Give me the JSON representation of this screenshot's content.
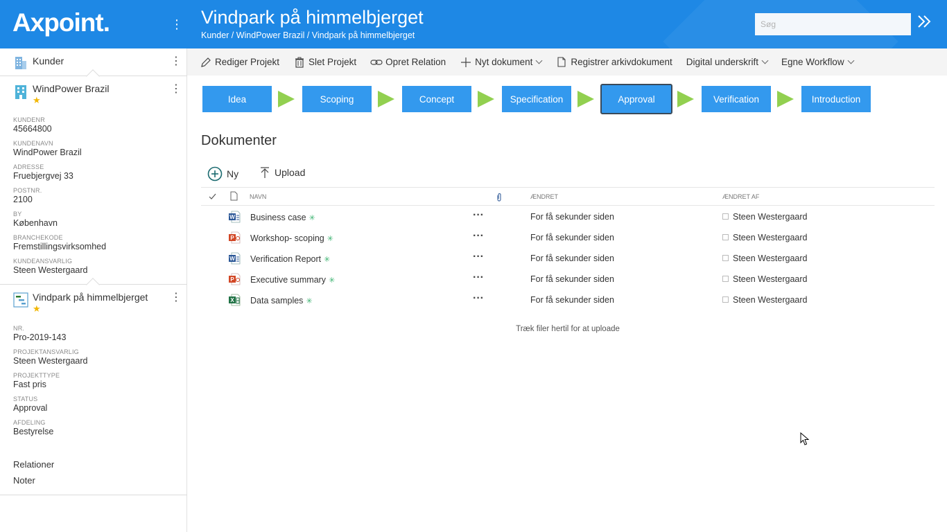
{
  "app": {
    "logo": "Axpoint."
  },
  "search": {
    "placeholder": "Søg"
  },
  "header": {
    "title": "Vindpark på himmelbjerget",
    "breadcrumb": [
      "Kunder",
      "WindPower Brazil",
      "Vindpark på himmelbjerget"
    ],
    "separator": " / "
  },
  "sidebar": {
    "root": {
      "label": "Kunder"
    },
    "customer": {
      "name": "WindPower Brazil",
      "starred": "★",
      "fields": [
        {
          "label": "KUNDENR",
          "value": "45664800"
        },
        {
          "label": "KUNDENAVN",
          "value": "WindPower Brazil"
        },
        {
          "label": "ADRESSE",
          "value": "Fruebjergvej 33"
        },
        {
          "label": "POSTNR.",
          "value": "2100"
        },
        {
          "label": "BY",
          "value": "København"
        },
        {
          "label": "BRANCHEKODE",
          "value": "Fremstillingsvirksomhed"
        },
        {
          "label": "KUNDEANSVARLIG",
          "value": "Steen Westergaard"
        }
      ]
    },
    "project": {
      "name": "Vindpark på himmelbjerget",
      "starred": "★",
      "fields": [
        {
          "label": "NR.",
          "value": "Pro-2019-143"
        },
        {
          "label": "PROJEKTANSVARLIG",
          "value": "Steen Westergaard"
        },
        {
          "label": "PROJEKTTYPE",
          "value": "Fast pris"
        },
        {
          "label": "STATUS",
          "value": "Approval"
        },
        {
          "label": "AFDELING",
          "value": "Bestyrelse"
        }
      ]
    },
    "links": [
      "Relationer",
      "Noter"
    ]
  },
  "toolbar": {
    "edit": "Rediger Projekt",
    "delete": "Slet Projekt",
    "relation": "Opret Relation",
    "new_doc": "Nyt dokument",
    "register": "Registrer arkivdokument",
    "signature": "Digital underskrift",
    "workflow": "Egne Workflow"
  },
  "phases": {
    "items": [
      "Idea",
      "Scoping",
      "Concept",
      "Specification",
      "Approval",
      "Verification",
      "Introduction"
    ],
    "active": "Approval"
  },
  "documents": {
    "title": "Dokumenter",
    "new_label": "Ny",
    "upload_label": "Upload",
    "columns": {
      "name": "NAVN",
      "modified": "ÆNDRET",
      "modified_by": "ÆNDRET AF"
    },
    "rows": [
      {
        "type": "word",
        "name": "Business case",
        "modified": "For få sekunder siden",
        "modified_by": "Steen Westergaard"
      },
      {
        "type": "powerpoint",
        "name": "Workshop- scoping",
        "modified": "For få sekunder siden",
        "modified_by": "Steen Westergaard"
      },
      {
        "type": "word",
        "name": "Verification Report",
        "modified": "For få sekunder siden",
        "modified_by": "Steen Westergaard"
      },
      {
        "type": "powerpoint",
        "name": "Executive summary",
        "modified": "For få sekunder siden",
        "modified_by": "Steen Westergaard"
      },
      {
        "type": "excel",
        "name": "Data samples",
        "modified": "For få sekunder siden",
        "modified_by": "Steen Westergaard"
      }
    ],
    "drop_hint": "Træk filer hertil for at uploade"
  },
  "colors": {
    "brand": "#1e88e5",
    "phase": "#3399ee",
    "phase_arrow": "#92d050",
    "star": "#f2b705"
  }
}
